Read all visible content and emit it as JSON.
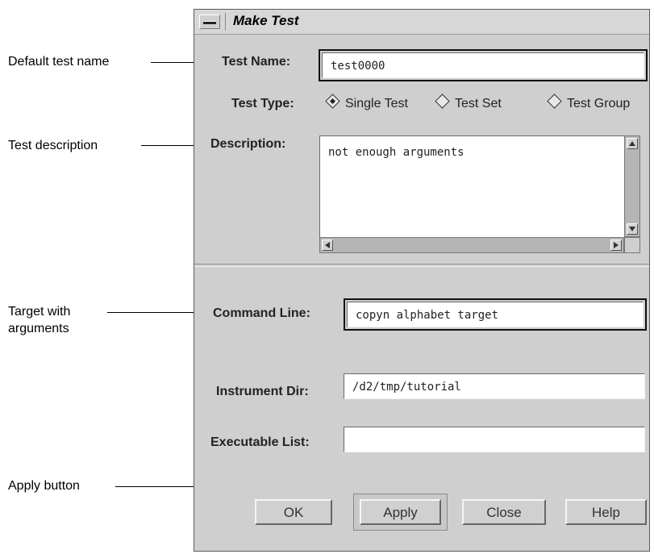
{
  "window": {
    "title": "Make Test"
  },
  "callouts": {
    "test_name": "Default test name",
    "description": "Test description",
    "target_line1": "Target with",
    "target_line2": "arguments",
    "apply": "Apply button"
  },
  "form": {
    "test_name_label": "Test Name:",
    "test_name_value": "test0000",
    "test_type_label": "Test Type:",
    "test_type_options": [
      "Single Test",
      "Test Set",
      "Test Group"
    ],
    "test_type_selected": "Single Test",
    "description_label": "Description:",
    "description_value": "not enough arguments",
    "command_line_label": "Command Line:",
    "command_line_value": "copyn alphabet target",
    "instrument_dir_label": "Instrument Dir:",
    "instrument_dir_value": "/d2/tmp/tutorial",
    "executable_list_label": "Executable List:",
    "executable_list_value": ""
  },
  "buttons": {
    "ok": "OK",
    "apply": "Apply",
    "close": "Close",
    "help": "Help"
  }
}
